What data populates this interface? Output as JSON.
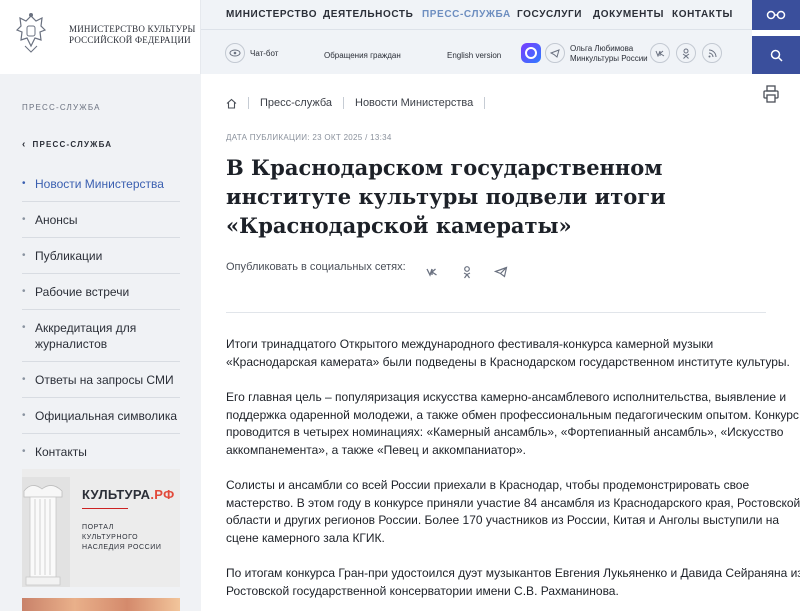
{
  "header": {
    "logo_line1": "МИНИСТЕРСТВО КУЛЬТУРЫ",
    "logo_line2": "РОССИЙСКОЙ ФЕДЕРАЦИИ",
    "nav": [
      "МИНИСТЕРСТВО",
      "ДЕЯТЕЛЬНОСТЬ",
      "ПРЕСС-СЛУЖБА",
      "ГОСУСЛУГИ",
      "ДОКУМЕНТЫ",
      "КОНТАКТЫ"
    ],
    "nav_active": "ПРЕСС-СЛУЖБА",
    "chatbot": "Чат-бот",
    "appeals": "Обращения граждан",
    "english": "English version",
    "minister_line1": "Ольга Любимова",
    "minister_line2": "Минкультуры России",
    "accent_color": "#3a4f9c"
  },
  "sidebar": {
    "section_title": "ПРЕСС-СЛУЖБА",
    "back_label": "ПРЕСС-СЛУЖБА",
    "items": [
      {
        "label": "Новости Министерства",
        "active": true
      },
      {
        "label": "Анонсы"
      },
      {
        "label": "Публикации"
      },
      {
        "label": "Рабочие встречи"
      },
      {
        "label": "Аккредитация для журналистов"
      },
      {
        "label": "Ответы на запросы СМИ"
      },
      {
        "label": "Официальная символика"
      },
      {
        "label": "Контакты"
      }
    ],
    "banner": {
      "brand": "КУЛЬТУРА",
      "brand_suffix": ".РФ",
      "sub_line1": "ПОРТАЛ",
      "sub_line2": "КУЛЬТУРНОГО",
      "sub_line3": "НАСЛЕДИЯ РОССИИ"
    }
  },
  "main": {
    "breadcrumb": [
      "Пресс-служба",
      "Новости Министерства"
    ],
    "pub_date": "ДАТА ПУБЛИКАЦИИ: 23 ОКТ 2025 / 13:34",
    "title_lines": [
      "В Краснодарском государственном",
      "институте культуры подвели итоги",
      "«Краснодарской камераты»"
    ],
    "share_label": "Опубликовать в социальных сетях:",
    "paragraphs": [
      [
        "Итоги тринадцатого Открытого международного фестиваля-конкурса камерной музыки",
        "«Краснодарская камерата» были подведены в Краснодарском государственном институте культуры."
      ],
      [
        "Его главная цель – популяризация искусства камерно-ансамблевого исполнительства, выявление и",
        "поддержка одаренной молодежи, а также обмен профессиональным педагогическим опытом. Конкурс",
        "проводится в четырех номинациях: «Камерный ансамбль», «Фортепианный ансамбль», «Искусство",
        "аккомпанемента», а также «Певец и аккомпаниатор»."
      ],
      [
        "Солисты и ансамбли со всей России приехали в Краснодар, чтобы продемонстрировать свое",
        "мастерство. В этом году в конкурсе приняли участие 84 ансамбля из Краснодарского края, Ростовской",
        "области и других регионов России. Более 170 участников из России, Китая и Анголы выступили на",
        "сцене камерного зала КГИК."
      ],
      [
        "По итогам конкурса Гран-при удостоился дуэт музыкантов Евгения Лукьяненко и Давида Сейраняна из",
        "Ростовской государственной консерватории имени С.В. Рахманинова."
      ]
    ]
  }
}
